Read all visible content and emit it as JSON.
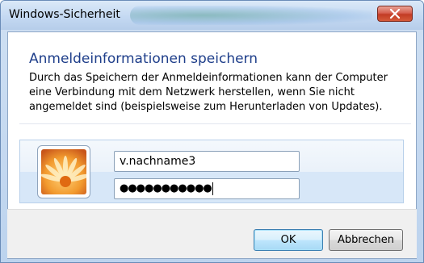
{
  "window": {
    "title": "Windows-Sicherheit"
  },
  "dialog": {
    "heading": "Anmeldeinformationen speichern",
    "description": "Durch das Speichern der Anmeldeinformationen kann der Computer eine Verbindung mit dem Netzwerk herstellen, wenn Sie nicht angemeldet sind (beispielsweise zum Herunterladen von Updates)."
  },
  "credentials": {
    "username": "v.nachname3",
    "password_mask": "●●●●●●●●●●●"
  },
  "buttons": {
    "ok": "OK",
    "cancel": "Abbrechen"
  },
  "icons": {
    "close": "close-icon",
    "avatar": "user-avatar-flower"
  },
  "colors": {
    "heading": "#1e3e8a",
    "close_button": "#c94a35",
    "ok_border": "#3c7fb1"
  }
}
